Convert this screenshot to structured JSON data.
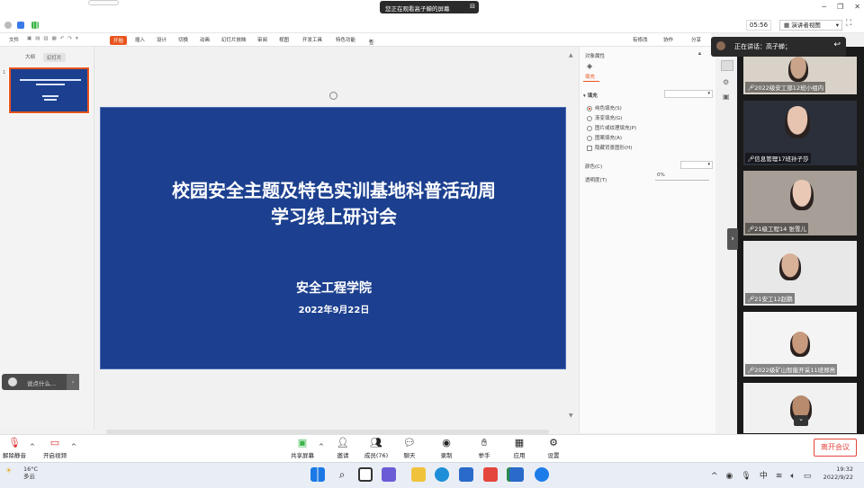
{
  "banner": {
    "viewing": "您正在观看高子蝉的屏幕"
  },
  "topbar": {
    "timer": "05:56",
    "view_label": "演讲者视图"
  },
  "ppt": {
    "toolbar": [
      "文件",
      "开始",
      "插入",
      "设计",
      "切换",
      "动画",
      "幻灯片放映",
      "审阅",
      "视图",
      "开发工具",
      "特色功能",
      "查找"
    ],
    "right_tools": [
      "有修改",
      "协作",
      "分享"
    ],
    "left_tabs": [
      "大纲",
      "幻灯片"
    ],
    "thumb_number": "1"
  },
  "slide": {
    "title_line1": "校园安全主题及特色实训基地科普活动周",
    "title_line2": "学习线上研讨会",
    "org": "安全工程学院",
    "date": "2022年9月22日"
  },
  "props": {
    "header": "对象属性",
    "tab": "填充",
    "section": "填充",
    "options": [
      "纯色填充(S)",
      "渐变填充(G)",
      "图片或纹理填充(P)",
      "图案填充(A)"
    ],
    "hide_bg": "隐藏背景图形(H)",
    "color_label": "颜色(C)",
    "transparency_label": "透明度(T)",
    "transparency_value": "0%"
  },
  "chat": {
    "placeholder": "说点什么..."
  },
  "speaking": "正在讲话：高子蝉；",
  "participants": [
    {
      "name": "2022级安工部12班小组内",
      "skin": "#c9a48a",
      "bg": "#d9d2c8"
    },
    {
      "name": "信息管理17班孙子莎",
      "skin": "#e7c4b0",
      "bg": "#2a2f3a"
    },
    {
      "name": "21级工程14 张雪儿",
      "skin": "#e9c9b6",
      "bg": "#a79f97"
    },
    {
      "name": "21安工12赵鹏",
      "skin": "#d8b199",
      "bg": "#e8e8e8"
    },
    {
      "name": "2022级矿山智能开采11班郑亮",
      "skin": "#c79a7e",
      "bg": "#f4f4f4"
    },
    {
      "name": "",
      "skin": "#b98b6d",
      "bg": "#f1f1f1"
    }
  ],
  "meeting_bar": {
    "mute": "解除静音",
    "video": "开启视频",
    "share": "共享屏幕",
    "invite": "邀请",
    "members": "成员(76)",
    "chat": "聊天",
    "record": "录制",
    "hand": "举手",
    "apps": "应用",
    "settings": "设置",
    "leave": "离开会议"
  },
  "taskbar": {
    "weather_temp": "16°C",
    "weather_desc": "多云",
    "time": "19:32",
    "date": "2022/9/22",
    "ime": "中"
  },
  "colors": {
    "accent": "#e8541e",
    "slide_bg": "#1c408f",
    "leave": "#e4463d"
  }
}
